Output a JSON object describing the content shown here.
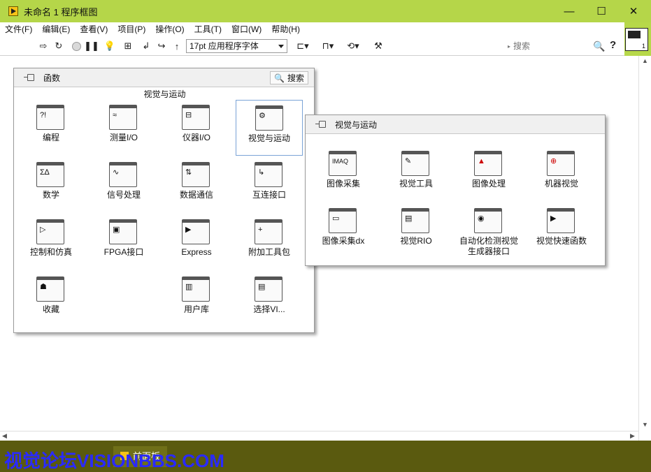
{
  "window": {
    "title": "未命名 1 程序框图",
    "controls": [
      "—",
      "☐",
      "✕"
    ]
  },
  "menu": {
    "items": [
      "文件(F)",
      "编辑(E)",
      "查看(V)",
      "项目(P)",
      "操作(O)",
      "工具(T)",
      "窗口(W)",
      "帮助(H)"
    ]
  },
  "toolbar": {
    "font": "17pt 应用程序字体",
    "search_placeholder": "搜索",
    "help": "?",
    "vi_icon_number": "1"
  },
  "functions_palette": {
    "title": "函数",
    "search_label": "搜索",
    "category": "视觉与运动",
    "tiles": [
      {
        "label": "编程",
        "icon": "programming-icon",
        "glyph": "?!"
      },
      {
        "label": "测量I/O",
        "icon": "measurement-io-icon",
        "glyph": "≈"
      },
      {
        "label": "仪器I/O",
        "icon": "instrument-io-icon",
        "glyph": "⊟"
      },
      {
        "label": "视觉与运动",
        "icon": "vision-motion-icon",
        "glyph": "⚙"
      },
      {
        "label": "数学",
        "icon": "math-icon",
        "glyph": "Σ∆"
      },
      {
        "label": "信号处理",
        "icon": "signal-processing-icon",
        "glyph": "∿"
      },
      {
        "label": "数据通信",
        "icon": "data-communication-icon",
        "glyph": "⇅"
      },
      {
        "label": "互连接口",
        "icon": "connectivity-icon",
        "glyph": "↳"
      },
      {
        "label": "控制和仿真",
        "icon": "control-simulation-icon",
        "glyph": "▷"
      },
      {
        "label": "FPGA接口",
        "icon": "fpga-interface-icon",
        "glyph": "▣"
      },
      {
        "label": "Express",
        "icon": "express-icon",
        "glyph": "▶"
      },
      {
        "label": "附加工具包",
        "icon": "addons-icon",
        "glyph": "+"
      },
      {
        "label": "收藏",
        "icon": "favorites-icon",
        "glyph": "☗"
      },
      {
        "label": "用户库",
        "icon": "user-libraries-icon",
        "glyph": "▥"
      },
      {
        "label": "选择VI...",
        "icon": "select-vi-icon",
        "glyph": "▤"
      }
    ]
  },
  "vision_palette": {
    "title": "视觉与运动",
    "tiles": [
      {
        "label": "图像采集",
        "icon": "imaq-icon",
        "glyph": "IMAQ"
      },
      {
        "label": "视觉工具",
        "icon": "vision-utilities-icon",
        "glyph": "✎"
      },
      {
        "label": "图像处理",
        "icon": "image-processing-icon",
        "glyph": "▲"
      },
      {
        "label": "机器视觉",
        "icon": "machine-vision-icon",
        "glyph": "⊕"
      },
      {
        "label": "图像采集dx",
        "icon": "imaqdx-icon",
        "glyph": "▭"
      },
      {
        "label": "视觉RIO",
        "icon": "vision-rio-icon",
        "glyph": "▤"
      },
      {
        "label": "自动化检测视觉\n生成器接口",
        "icon": "vision-builder-icon",
        "glyph": "◉"
      },
      {
        "label": "视觉快速函数",
        "icon": "vision-express-icon",
        "glyph": "▶"
      }
    ]
  },
  "taskbar": {
    "item": "前面板"
  },
  "watermark": "视觉论坛VISIONBBS.COM"
}
